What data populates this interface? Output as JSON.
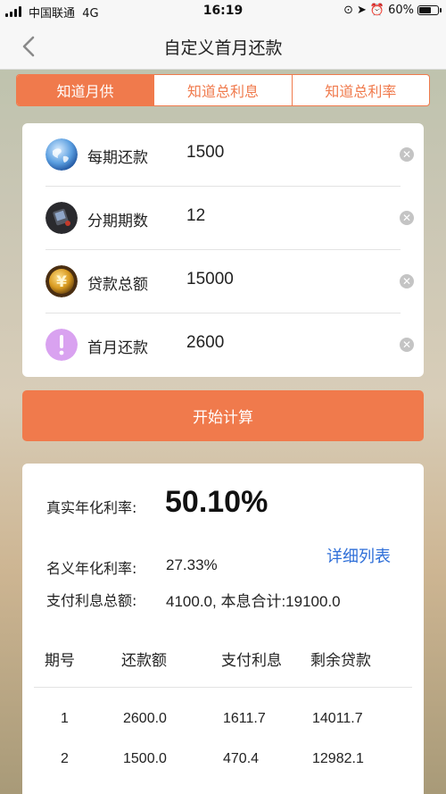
{
  "status_bar": {
    "carrier": "中国联通",
    "network": "4G",
    "time": "16:19",
    "battery": "60%",
    "battery_level": 0.6
  },
  "nav": {
    "title": "自定义首月还款"
  },
  "tabs": [
    {
      "label": "知道月供",
      "active": true
    },
    {
      "label": "知道总利息",
      "active": false
    },
    {
      "label": "知道总利率",
      "active": false
    }
  ],
  "inputs": [
    {
      "label": "每期还款",
      "value": "1500",
      "icon": "globe-icon"
    },
    {
      "label": "分期期数",
      "value": "12",
      "icon": "device-icon"
    },
    {
      "label": "贷款总额",
      "value": "15000",
      "icon": "yuan-coin-icon"
    },
    {
      "label": "首月还款",
      "value": "2600",
      "icon": "exclamation-icon"
    }
  ],
  "calc_button": "开始计算",
  "result": {
    "real_rate_label": "真实年化利率:",
    "real_rate_value": "50.10%",
    "detail_link": "详细列表",
    "nominal_rate_label": "名义年化利率:",
    "nominal_rate_value": "27.33%",
    "interest_label": "支付利息总额:",
    "interest_value": "4100.0, 本息合计:19100.0"
  },
  "table": {
    "headers": [
      "期号",
      "还款额",
      "支付利息",
      "剩余贷款"
    ],
    "rows": [
      [
        "1",
        "2600.0",
        "1611.7",
        "14011.7"
      ],
      [
        "2",
        "1500.0",
        "470.4",
        "12982.1"
      ]
    ]
  },
  "colors": {
    "accent": "#f07a4c",
    "link": "#2f6fd8"
  }
}
